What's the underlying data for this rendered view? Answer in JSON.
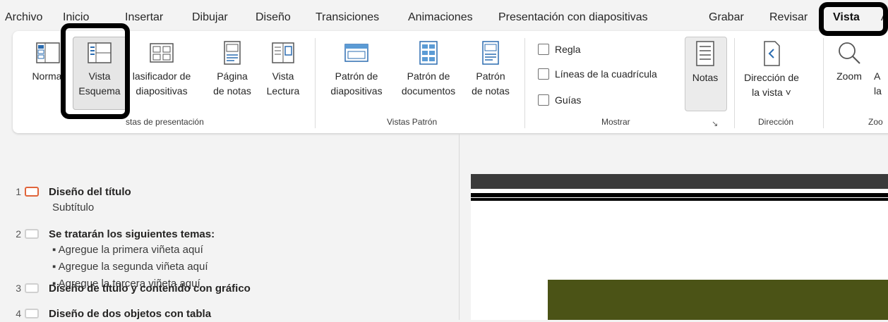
{
  "tabs": {
    "archivo": "Archivo",
    "inicio": "Inicio",
    "insertar": "Insertar",
    "dibujar": "Dibujar",
    "diseno": "Diseño",
    "transiciones": "Transiciones",
    "animaciones": "Animaciones",
    "presentacion": "Presentación con diapositivas",
    "grabar": "Grabar",
    "revisar": "Revisar",
    "vista": "Vista",
    "overflow": "A"
  },
  "ribbon": {
    "normal": "Normal",
    "vista_esquema_1": "Vista",
    "vista_esquema_2": "Esquema",
    "clasificador_1": "lasificador de",
    "clasificador_2": "diapositivas",
    "pagina_notas_1": "Página",
    "pagina_notas_2": "de notas",
    "vista_lectura_1": "Vista",
    "vista_lectura_2": "Lectura",
    "group_vistas_presentacion": "stas de presentación",
    "patron_diap_1": "Patrón de",
    "patron_diap_2": "diapositivas",
    "patron_doc_1": "Patrón de",
    "patron_doc_2": "documentos",
    "patron_notas_1": "Patrón",
    "patron_notas_2": "de notas",
    "group_vistas_patron": "Vistas Patrón",
    "regla": "Regla",
    "lineas": "Líneas de la cuadrícula",
    "guias": "Guías",
    "notas": "Notas",
    "group_mostrar": "Mostrar",
    "direccion_1": "Dirección de",
    "direccion_2": "la vista ˅",
    "group_direccion": "Dirección",
    "zoom": "Zoom",
    "ajustar_1": "A",
    "ajustar_2": "la",
    "group_zoom": "Zoo"
  },
  "outline": {
    "slides": [
      {
        "num": "1",
        "title": "Diseño del título",
        "subtitle": "Subtítulo"
      },
      {
        "num": "2",
        "title": "Se tratarán los siguientes temas:",
        "bullets": [
          "Agregue la primera viñeta aquí",
          "Agregue la segunda viñeta aquí",
          "Agregue la tercera viñeta aquí"
        ]
      },
      {
        "num": "3",
        "title": "Diseño de título y contenido con gráfico"
      },
      {
        "num": "4",
        "title": "Diseño de dos objetos con tabla"
      }
    ]
  },
  "colors": {
    "highlight_box": "#000000",
    "active_thumb": "#e0643a",
    "slide_band": "#4b5316"
  }
}
